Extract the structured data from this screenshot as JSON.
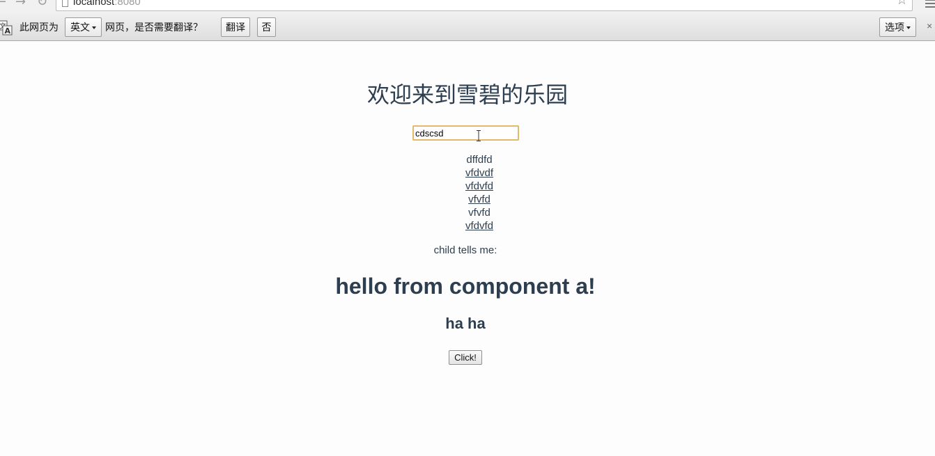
{
  "browser": {
    "url_host": "localhost",
    "url_port": ":8080",
    "nav_icons": [
      "back-arrow-icon",
      "forward-arrow-icon",
      "reload-icon"
    ],
    "star_icon": "star-icon",
    "menu_icon": "hamburger-menu-icon"
  },
  "translate_bar": {
    "prefix": "此网页为",
    "language": "英文",
    "suffix": "网页，是否需要翻译？",
    "translate_label": "翻译",
    "no_label": "否",
    "options_label": "选项",
    "close_glyph": "×"
  },
  "page": {
    "title": "欢迎来到雪碧的乐园",
    "input_value": "cdscsd",
    "items": [
      {
        "text": "dffdfd",
        "linked": false
      },
      {
        "text": "vfdvdf",
        "linked": true
      },
      {
        "text": "vfdvfd",
        "linked": true
      },
      {
        "text": "vfvfd",
        "linked": true
      },
      {
        "text": "vfvfd",
        "linked": false
      },
      {
        "text": "vfdvfd",
        "linked": true
      }
    ],
    "child_tells": "child tells me:",
    "headline": "hello from component a!",
    "subhead": "ha ha",
    "button_label": "Click!"
  },
  "colors": {
    "text": "#2c3e50",
    "input_focus_border": "#e3b96a",
    "page_background": "#fdfdfd"
  }
}
